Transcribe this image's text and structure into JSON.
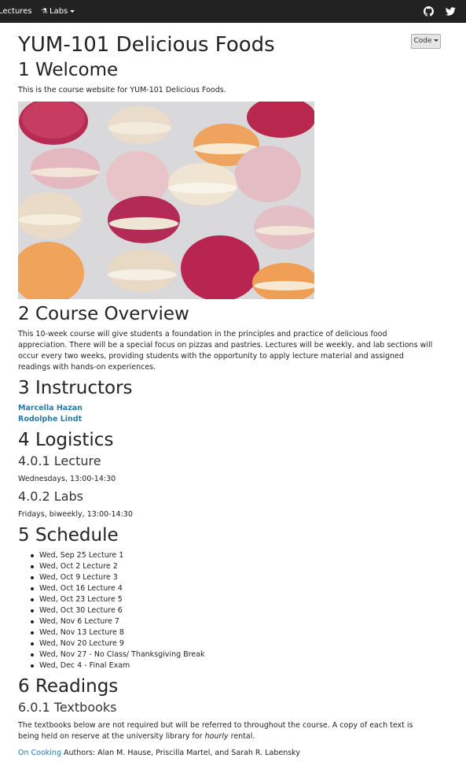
{
  "navbar": {
    "lectures_label": "Lectures",
    "labs_label": "Labs",
    "github_icon": "github-icon",
    "twitter_icon": "twitter-icon"
  },
  "code_button": {
    "label": "Code"
  },
  "page": {
    "title": "YUM-101 Delicious Foods",
    "welcome": {
      "heading": "1 Welcome",
      "text": "This is the course website for YUM-101 Delicious Foods.",
      "image": "macarons-photo"
    },
    "overview": {
      "heading": "2 Course Overview",
      "text": "This 10-week course will give students a foundation in the principles and practice of delicious food appreciation. There will be a special focus on pizzas and pastries. Lectures will be weekly, and lab sections will occur every two weeks, providing students with the opportunity to apply lecture material and assigned readings with hands-on experiences."
    },
    "instructors": {
      "heading": "3 Instructors",
      "names": [
        "Marcella Hazan",
        "Rodolphe Lindt"
      ]
    },
    "logistics": {
      "heading": "4 Logistics",
      "lecture_heading": "4.0.1 Lecture",
      "lecture_time": "Wednesdays, 13:00-14:30",
      "labs_heading": "4.0.2 Labs",
      "labs_time": "Fridays, biweekly, 13:00-14:30"
    },
    "schedule": {
      "heading": "5 Schedule",
      "items": [
        "Wed, Sep 25 Lecture 1",
        "Wed, Oct 2 Lecture 2",
        "Wed, Oct 9 Lecture 3",
        "Wed, Oct 16 Lecture 4",
        "Wed, Oct 23 Lecture 5",
        "Wed, Oct 30 Lecture 6",
        "Wed, Nov 6 Lecture 7",
        "Wed, Nov 13 Lecture 8",
        "Wed, Nov 20 Lecture 9",
        "Wed, Nov 27 - No Class/ Thanksgiving Break",
        "Wed, Dec 4 - Final Exam"
      ]
    },
    "readings": {
      "heading": "6 Readings",
      "textbooks_heading": "6.0.1 Textbooks",
      "textbooks_text_before": "The textbooks below are not required but will be referred to throughout the course. A copy of each text is being held on reserve at the university library for ",
      "textbooks_text_emph": "hourly",
      "textbooks_text_after": " rental.",
      "book_title": "On Cooking",
      "book_authors": " Authors: Alan M. Hause, Priscilla Martel, and Sarah R. Labensky"
    }
  },
  "colors": {
    "navbar_bg": "#222222",
    "link": "#2a7aa8"
  }
}
